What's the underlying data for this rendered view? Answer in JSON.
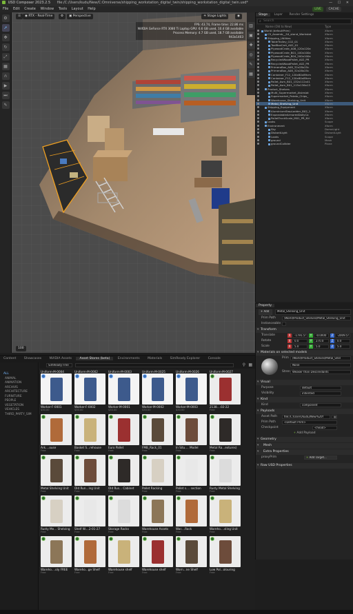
{
  "app": {
    "title": "USD Composer",
    "version": "2023.2.5",
    "file_path": "file:/C:/Users/kudu/New/C:Omniverse/shipping_workstation_digital_twin/shipping_workstation_digital_twin.usd*",
    "live_label": "LIVE",
    "cache_label": "CACHE"
  },
  "menu": [
    "File",
    "Edit",
    "Create",
    "Window",
    "Tools",
    "Layout",
    "Help"
  ],
  "viewport": {
    "render_mode": "RTX - Real-Time",
    "camera": "Perspective",
    "stage_lights": "Stage Lights",
    "stats": [
      "FPS: 43.74, Frame time: 22.86 ms",
      "NVIDIA GeForce RTX 3080 Ti Laptop GPU: 6.6 GB used, 10.4 GB available",
      "Process Memory: 4.7 GB used, 18.7 GB available",
      "943x1403"
    ],
    "corner_label": "100"
  },
  "stage": {
    "tabs": [
      "Stage",
      "Layer",
      "Render Settings"
    ],
    "search_placeholder": "Search",
    "col_name": "Name (Old to New)",
    "col_type": "Type",
    "rows": [
      {
        "name": "World (defaultPrim)",
        "type": "Xform"
      },
      {
        "name": "C5_Assemb__S4_stand_Workstat",
        "type": "Xform"
      },
      {
        "name": "Shipping_Utilities",
        "type": "Xform"
      },
      {
        "name": "TableTrolley_C02_01",
        "type": "Xform"
      },
      {
        "name": "ToolBoxCart_A02_01",
        "type": "Xform"
      },
      {
        "name": "PlywoodCrate_A08_120x120x",
        "type": "Xform"
      },
      {
        "name": "PlywoodCrate_B01_100x100x",
        "type": "Xform"
      },
      {
        "name": "PlywoodCrate_B04_200x100x",
        "type": "Xform"
      },
      {
        "name": "RecycledWoodPallet_A02_PR",
        "type": "Xform"
      },
      {
        "name": "RecycledWoodPallet_A02_PR",
        "type": "Xform"
      },
      {
        "name": "PrimeroBox_A08_32x28x25c",
        "type": "Xform"
      },
      {
        "name": "PrimeroBox_A08_32x28x25c",
        "type": "Xform"
      },
      {
        "name": "Container_F12_120x80x89cm",
        "type": "Xform"
      },
      {
        "name": "Container_F12_120x80x89cm",
        "type": "Xform"
      },
      {
        "name": "Pallet_Asm_B01_132x112x41",
        "type": "Xform"
      },
      {
        "name": "Pallet_Asm_B01_115x136x13",
        "type": "Xform"
      },
      {
        "name": "Product_Shelves",
        "type": "Xform"
      },
      {
        "name": "Multi_Supermarket_Aisleslot",
        "type": "Xform"
      },
      {
        "name": "Supermarket_Potato_Chips_",
        "type": "Xform"
      },
      {
        "name": "Warehouse_Shelving_Unit",
        "type": "Xform"
      },
      {
        "name": "Metal_Shelving_Unit",
        "type": "Xform"
      },
      {
        "name": "Shipping_Equipment",
        "type": "Xform"
      },
      {
        "name": "AluminiumStepLadder_B02_1",
        "type": "Xform"
      },
      {
        "name": "ExpandableArmoredDollyCa",
        "type": "Xform"
      },
      {
        "name": "PalletTruckScale_M01_PR_NV",
        "type": "Xform"
      },
      {
        "name": "Looks",
        "type": "Scope"
      },
      {
        "name": "Environment",
        "type": "Xform"
      },
      {
        "name": "Sky",
        "type": "DomeLight"
      },
      {
        "name": "DistantLight",
        "type": "DistantLight"
      },
      {
        "name": "Looks",
        "type": "Scope"
      },
      {
        "name": "ground",
        "type": "Mesh"
      },
      {
        "name": "groundCollider",
        "type": "Plane"
      }
    ]
  },
  "property": {
    "tab": "Property",
    "add_label": "Add",
    "name_value": "Metal_Shelving_Unit",
    "prim_path_label": "Prim Path",
    "prim_path": "/World/Product_Shelves/Metal_Shelving_Unit",
    "instanceable_label": "Instanceable",
    "transform_title": "Transform",
    "translate_label": "Translate",
    "translate": [
      "-1791.5!",
      "-0.0000",
      "-2009.5!"
    ],
    "rotate_label": "Rotate",
    "rotate": [
      "0.0",
      "270.0",
      "0.0"
    ],
    "scale_label": "Scale",
    "scale": [
      "5.0",
      "5.0",
      "5.0"
    ],
    "materials_title": "Materials on selected models",
    "prim_label": "Prim",
    "material_prim": "/World/Product_Shelves/Metal_Shel",
    "material_none": "None",
    "strength_label": "Strength",
    "strength_value": "Weaker than Descendants",
    "visual_title": "Visual",
    "purpose_label": "Purpose",
    "purpose_value": "default",
    "visibility_label": "Visibility",
    "visibility_value": "inherited",
    "kind_title": "Kind",
    "kind_label": "Kind",
    "kind_value": "component",
    "payloads_title": "Payloads",
    "asset_path_label": "Asset Path",
    "asset_path": "file:/C:/Users/kudu/New%20f",
    "payload_prim_path_label": "Prim Path",
    "payload_prim_path": "<Default Prim>",
    "checkpoint_label": "Checkpoint",
    "checkpoint_value": "<head>",
    "add_payload": "Add Payload",
    "geometry_title": "Geometry",
    "mesh_title": "Mesh",
    "extra_props_title": "Extra Properties",
    "proxy_prim_label": "proxyPrim",
    "add_target": "Add Target...",
    "raw_usd_title": "Raw USD Properties"
  },
  "content": {
    "tabs": [
      "Content",
      "Showcases",
      "NVIDIA Assets",
      "Asset Stores (beta)",
      "Environments",
      "Materials",
      "SimReady Explorer",
      "Console"
    ],
    "active_tab": "Asset Stores (beta)",
    "store_select": "SimReady Free",
    "categories": [
      "ALL",
      "ANIMAL",
      "ANIMATION",
      "ARCHVIS",
      "ARCHITECTURE",
      "FURNITURE",
      "PEOPLE",
      "VEGETATION",
      "VEHICLES",
      "THIRD_PARTY_SIM"
    ],
    "top_row": [
      {
        "name": "Uniform-M-0004",
        "sub": "$30.00"
      },
      {
        "name": "Uniform-M-0002",
        "sub": "$30.00"
      },
      {
        "name": "Uniform-M-0003",
        "sub": "$30.00"
      },
      {
        "name": "Uniform-M-0025",
        "sub": "$30.00"
      },
      {
        "name": "Uniform-M-0026",
        "sub": "$30.00"
      },
      {
        "name": "Uniform-M-0027",
        "sub": "$30.00"
      }
    ],
    "assets": [
      {
        "name": "Worker-F-0001",
        "sub": "$30.00"
      },
      {
        "name": "Worker-F-0002",
        "sub": "$30.00"
      },
      {
        "name": "Worker-M-0001",
        "sub": "$30.00"
      },
      {
        "name": "Worker-M-0002",
        "sub": "$30.00"
      },
      {
        "name": "Worker-M-0003",
        "sub": "$30.00"
      },
      {
        "name": "2138....02-22",
        "sub": "Free"
      },
      {
        "name": "Ark....ouse",
        "sub": "Free"
      },
      {
        "name": "Basket S...rehouse",
        "sub": "Free"
      },
      {
        "name": "Euro Pallet",
        "sub": "Free"
      },
      {
        "name": "FMB_Rack_01",
        "sub": "Free"
      },
      {
        "name": "In Situ.... Model",
        "sub": "Free"
      },
      {
        "name": "Metal Ra...extures)",
        "sub": "Free"
      },
      {
        "name": "Metal Shelving Unit",
        "sub": "Free"
      },
      {
        "name": "Old Run...ing Unit",
        "sub": "Free"
      },
      {
        "name": "Old Rus... Cabinet",
        "sub": "Free"
      },
      {
        "name": "Pallet Racking",
        "sub": "Free"
      },
      {
        "name": "Pallet s.... section",
        "sub": "Free"
      },
      {
        "name": "Rusty Metal Shelving",
        "sub": "Free"
      },
      {
        "name": "Rusty Me... Shelving",
        "sub": "Free"
      },
      {
        "name": "Shelf W....2-01-27",
        "sub": "Free"
      },
      {
        "name": "Storage Racks",
        "sub": "Free"
      },
      {
        "name": "Warehouse Assets",
        "sub": "Free"
      },
      {
        "name": "War....Rack",
        "sub": "Free"
      },
      {
        "name": "Wareho....sling Unit",
        "sub": "Free"
      },
      {
        "name": "Wareho....oly FREE",
        "sub": "Free"
      },
      {
        "name": "Wareho...ge Shelf",
        "sub": "Free"
      },
      {
        "name": "Warehouse shelf",
        "sub": "Free"
      },
      {
        "name": "Warehouse shelf",
        "sub": "Free"
      },
      {
        "name": "Worn...ne Shelf",
        "sub": "Free"
      },
      {
        "name": "Low Pol...olouring",
        "sub": "Free"
      }
    ]
  }
}
